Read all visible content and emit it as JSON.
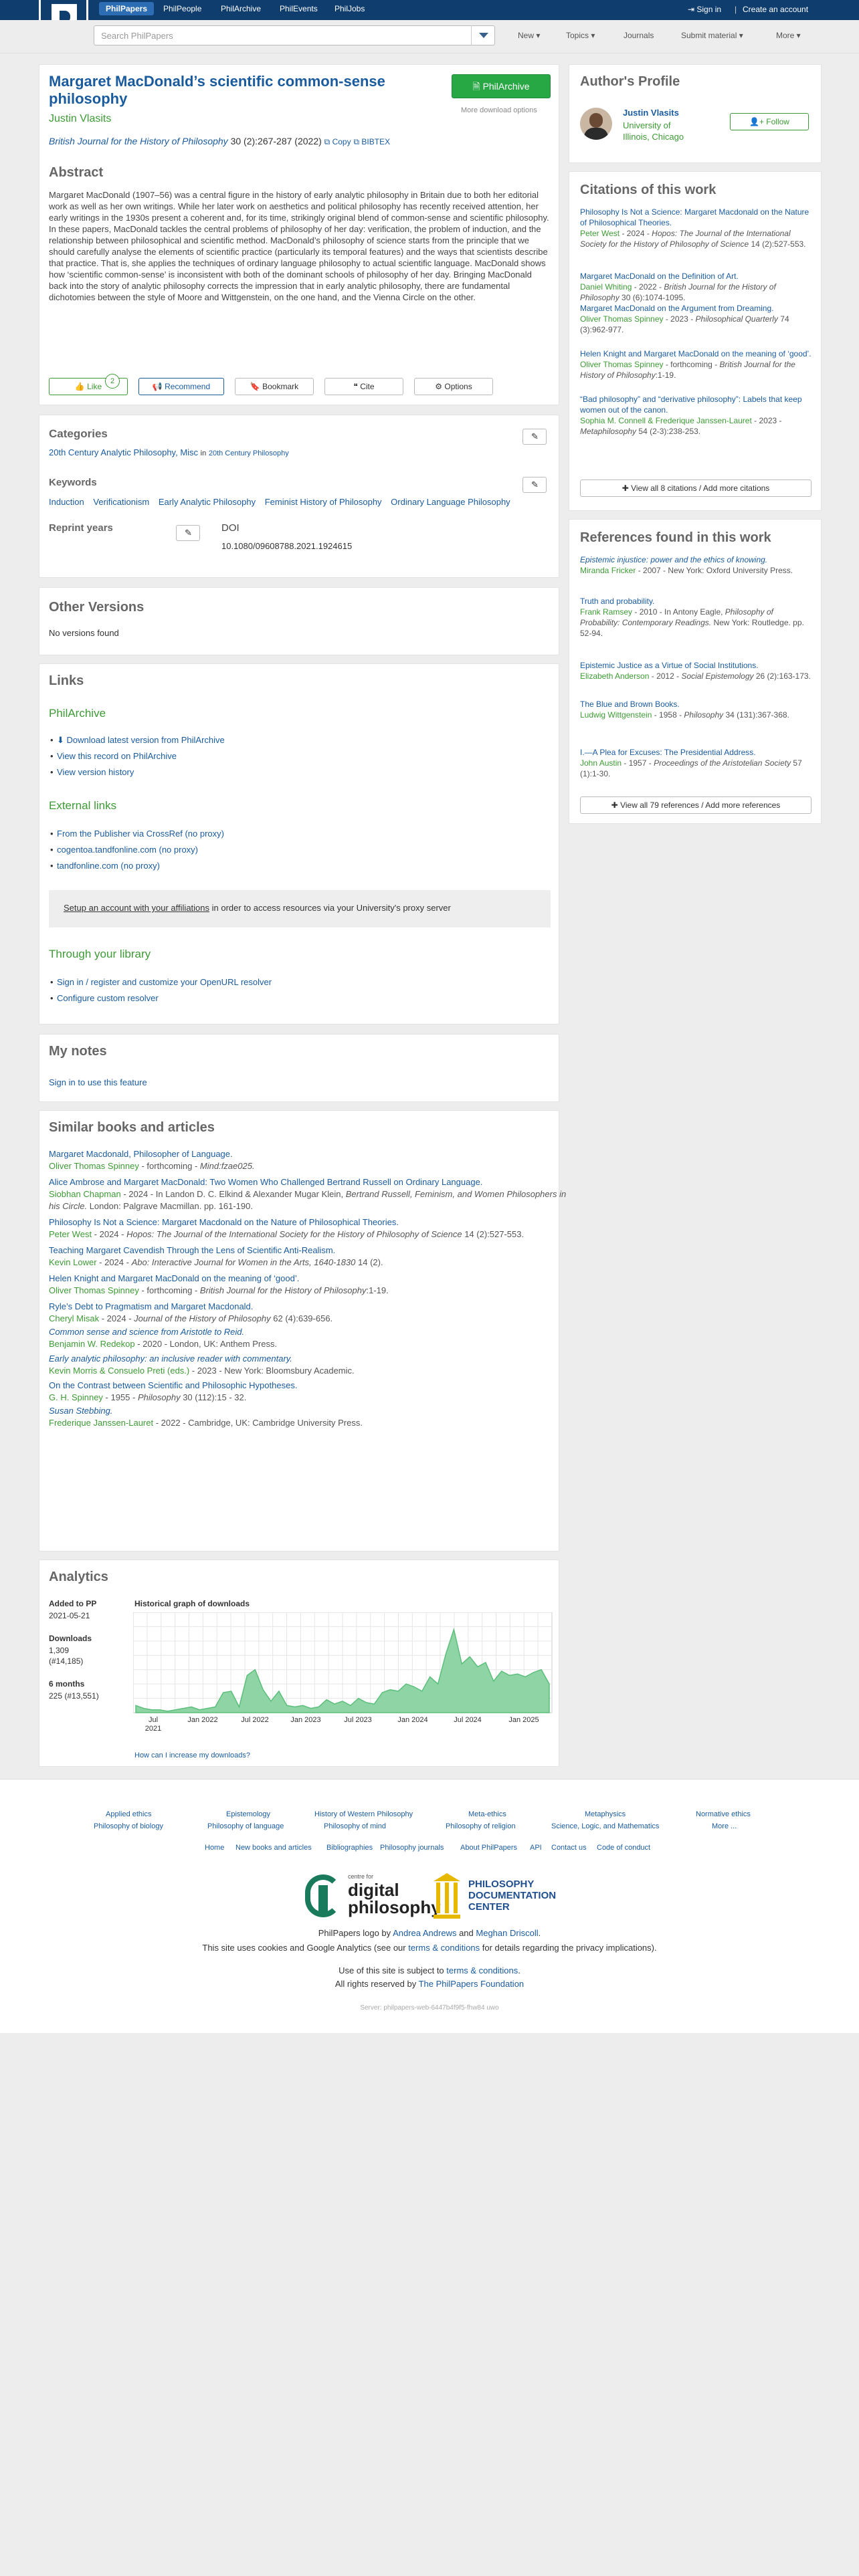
{
  "nav": {
    "brand": "PhilPapers",
    "items": [
      "PhilPeople",
      "PhilArchive",
      "PhilEvents",
      "PhilJobs"
    ],
    "sign_in": "Sign in",
    "create_account": "Create an account"
  },
  "search": {
    "placeholder": "Search PhilPapers"
  },
  "menu": [
    "New",
    "Topics",
    "Journals",
    "Submit material",
    "More"
  ],
  "article": {
    "title": "Margaret MacDonald’s scientific common-sense philosophy",
    "author": "Justin Vlasits",
    "journal": "British Journal for the History of Philosophy",
    "citation": "30 (2):267-287 (2022)",
    "copy": "Copy",
    "bibtex": "BIBTEX",
    "philarchive_btn": "PhilArchive",
    "more_download": "More download options",
    "abstract_heading": "Abstract",
    "abstract": "Margaret MacDonald (1907–56) was a central figure in the history of early analytic philosophy in Britain due to both her editorial work as well as her own writings. While her later work on aesthetics and political philosophy has recently received attention, her early writings in the 1930s present a coherent and, for its time, strikingly original blend of common-sense and scientific philosophy. In these papers, MacDonald tackles the central problems of philosophy of her day: verification, the problem of induction, and the relationship between philosophical and scientific method. MacDonald’s philosophy of science starts from the principle that we should carefully analyse the elements of scientific practice (particularly its temporal features) and the ways that scientists describe that practice. That is, she applies the techniques of ordinary language philosophy to actual scientific language. MacDonald shows how ‘scientific common-sense’ is inconsistent with both of the dominant schools of philosophy of her day. Bringing MacDonald back into the story of analytic philosophy corrects the impression that in early analytic philosophy, there are fundamental dichotomies between the style of Moore and Wittgenstein, on the one hand, and the Vienna Circle on the other.",
    "actions": {
      "like": "Like",
      "like_count": "2",
      "recommend": "Recommend",
      "bookmark": "Bookmark",
      "cite": "Cite",
      "options": "Options"
    }
  },
  "categories": {
    "heading": "Categories",
    "main": "20th Century Analytic Philosophy, Misc",
    "in": "in",
    "parent": "20th Century Philosophy",
    "keywords_heading": "Keywords",
    "keywords": [
      "Induction",
      "Verificationism",
      "Early Analytic Philosophy",
      "Feminist History of Philosophy",
      "Ordinary Language Philosophy"
    ],
    "reprint_heading": "Reprint years",
    "doi_heading": "DOI",
    "doi": "10.1080/09608788.2021.1924615"
  },
  "versions": {
    "heading": "Other Versions",
    "text": "No versions found"
  },
  "links": {
    "heading": "Links",
    "philarchive_heading": "PhilArchive",
    "philarchive": [
      "Download latest version from PhilArchive",
      "View this record on PhilArchive",
      "View version history"
    ],
    "external_heading": "External links",
    "external": [
      "From the Publisher via CrossRef (no proxy)",
      "cogentoa.tandfonline.com (no proxy)",
      "tandfonline.com (no proxy)"
    ],
    "proxy_link": "Setup an account with your affiliations",
    "proxy_text": " in order to access resources via your University's proxy server",
    "library_heading": "Through your library",
    "library": [
      "Sign in / register and customize your OpenURL resolver",
      "Configure custom resolver"
    ]
  },
  "notes": {
    "heading": "My notes",
    "sign_in": "Sign in to use this feature"
  },
  "similar": {
    "heading": "Similar books and articles",
    "items": [
      {
        "title": "Margaret Macdonald, Philosopher of Language.",
        "authors": "Oliver Thomas Spinney",
        "meta": " - forthcoming - ",
        "venue": "Mind:fzae025."
      },
      {
        "title": "Alice Ambrose and Margaret MacDonald: Two Women Who Challenged Bertrand Russell on Ordinary Language.",
        "authors": "Siobhan Chapman",
        "meta": " - 2024 - In Landon D. C. Elkind & Alexander Mugar Klein, ",
        "venue": "Bertrand Russell, Feminism, and Women Philosophers in his Circle.",
        "tail": " London: Palgrave Macmillan. pp. 161-190."
      },
      {
        "title": "Philosophy Is Not a Science: Margaret Macdonald on the Nature of Philosophical Theories.",
        "authors": "Peter West",
        "meta": " - 2024 - ",
        "venue": "Hopos: The Journal of the International Society for the History of Philosophy of Science",
        "tail": " 14 (2):527-553."
      },
      {
        "title": "Teaching Margaret Cavendish Through the Lens of Scientific Anti-Realism.",
        "authors": "Kevin Lower",
        "meta": " - 2024 - ",
        "venue": "Abo: Interactive Journal for Women in the Arts, 1640-1830",
        "tail": " 14 (2)."
      },
      {
        "title": "Helen Knight and Margaret MacDonald on the meaning of ‘good’.",
        "authors": "Oliver Thomas Spinney",
        "meta": " - forthcoming - ",
        "venue": "British Journal for the History of Philosophy",
        "tail": ":1-19."
      },
      {
        "title": "Ryle’s Debt to Pragmatism and Margaret Macdonald.",
        "authors": "Cheryl Misak",
        "meta": " - 2024 - ",
        "venue": "Journal of the History of Philosophy",
        "tail": " 62 (4):639-656."
      },
      {
        "title": "Common sense and science from Aristotle to Reid.",
        "authors": "Benjamin W. Redekop",
        "meta": " - 2020 - London, UK: Anthem Press.",
        "venue": "",
        "tail": "",
        "italic_title": true
      },
      {
        "title": "Early analytic philosophy: an inclusive reader with commentary.",
        "authors": "Kevin Morris & Consuelo Preti (eds.)",
        "meta": " - 2023 - New York: Bloomsbury Academic.",
        "venue": "",
        "tail": "",
        "italic_title": true
      },
      {
        "title": "On the Contrast between Scientific and Philosophic Hypotheses.",
        "authors": "G. H. Spinney",
        "meta": " - 1955 - ",
        "venue": "Philosophy",
        "tail": " 30 (112):15 - 32."
      },
      {
        "title": "Susan Stebbing.",
        "authors": "Frederique Janssen-Lauret",
        "meta": " - 2022 - Cambridge, UK: Cambridge University Press.",
        "venue": "",
        "tail": "",
        "italic_title": true
      }
    ]
  },
  "analytics": {
    "heading": "Analytics",
    "added_label": "Added to PP",
    "added": "2021-05-21",
    "downloads_label": "Downloads",
    "downloads": "1,309",
    "downloads_rank": "(#14,185)",
    "six_label": "6 months",
    "six": "225 (#13,551)",
    "graph_title": "Historical graph of downloads",
    "increase_link": "How can I increase my downloads?"
  },
  "chart_data": {
    "type": "area",
    "title": "Historical graph of downloads",
    "x_ticks": [
      "Jul 2021",
      "Jan 2022",
      "Jul 2022",
      "Jan 2023",
      "Jul 2023",
      "Jan 2024",
      "Jul 2024",
      "Jan 2025"
    ],
    "values": [
      5,
      3,
      2,
      2,
      1,
      2,
      3,
      4,
      2,
      3,
      4,
      14,
      15,
      4,
      26,
      30,
      16,
      8,
      15,
      5,
      4,
      5,
      3,
      4,
      9,
      6,
      8,
      5,
      10,
      7,
      6,
      14,
      16,
      15,
      20,
      18,
      15,
      25,
      20,
      41,
      58,
      34,
      39,
      32,
      35,
      22,
      29,
      26,
      27,
      25,
      28,
      30,
      20
    ],
    "ylim": [
      0,
      70
    ],
    "grid": true,
    "color": "#8fd4a4"
  },
  "profile": {
    "heading": "Author's Profile",
    "name": "Justin Vlasits",
    "affiliation": "University of Illinois, Chicago",
    "follow": "Follow"
  },
  "citations": {
    "heading": "Citations of this work",
    "items": [
      {
        "title": "Philosophy Is Not a Science: Margaret Macdonald on the Nature of Philosophical Theories.",
        "authors": "Peter West",
        "meta": " - 2024 - ",
        "venue": "Hopos: The Journal of the International Society for the History of Philosophy of Science",
        "tail": " 14 (2):527-553."
      },
      {
        "title": "Margaret MacDonald on the Definition of Art.",
        "authors": "Daniel Whiting",
        "meta": " - 2022 - ",
        "venue": "British Journal for the History of Philosophy",
        "tail": " 30 (6):1074-1095."
      },
      {
        "title": "Margaret MacDonald on the Argument from Dreaming.",
        "authors": "Oliver Thomas Spinney",
        "meta": " - 2023 - ",
        "venue": "Philosophical Quarterly",
        "tail": " 74 (3):962-977."
      },
      {
        "title": "Helen Knight and Margaret MacDonald on the meaning of ‘good’.",
        "authors": "Oliver Thomas Spinney",
        "meta": " - forthcoming - ",
        "venue": "British Journal for the History of Philosophy",
        "tail": ":1-19."
      },
      {
        "title": "“Bad philosophy” and “derivative philosophy”: Labels that keep women out of the canon.",
        "authors": "Sophia M. Connell & Frederique Janssen-Lauret",
        "meta": " - 2023 - ",
        "venue": "Metaphilosophy",
        "tail": " 54 (2-3):238-253."
      }
    ],
    "view_all": "View all 8 citations / Add more citations"
  },
  "references": {
    "heading": "References found in this work",
    "items": [
      {
        "title": "Epistemic injustice: power and the ethics of knowing.",
        "authors": "Miranda Fricker",
        "meta": " - 2007 - New York: Oxford University Press.",
        "venue": "",
        "tail": "",
        "italic_title": true
      },
      {
        "title": "Truth and probability.",
        "authors": "Frank Ramsey",
        "meta": " - 2010 - In Antony Eagle, ",
        "venue": "Philosophy of Probability: Contemporary Readings.",
        "tail": " New York: Routledge. pp. 52-94."
      },
      {
        "title": "Epistemic Justice as a Virtue of Social Institutions.",
        "authors": "Elizabeth Anderson",
        "meta": " - 2012 - ",
        "venue": "Social Epistemology",
        "tail": " 26 (2):163-173."
      },
      {
        "title": "The Blue and Brown Books.",
        "authors": "Ludwig Wittgenstein",
        "meta": " - 1958 - ",
        "venue": "Philosophy",
        "tail": " 34 (131):367-368."
      },
      {
        "title": "I.—A Plea for Excuses: The Presidential Address.",
        "authors": "John Austin",
        "meta": " - 1957 - ",
        "venue": "Proceedings of the Aristotelian Society",
        "tail": " 57 (1):1-30."
      }
    ],
    "view_all": "View all 79 references / Add more references"
  },
  "footer": {
    "row1": [
      "Applied ethics",
      "Epistemology",
      "History of Western Philosophy",
      "Meta-ethics",
      "Metaphysics",
      "Normative ethics"
    ],
    "row2": [
      "Philosophy of biology",
      "Philosophy of language",
      "Philosophy of mind",
      "Philosophy of religion",
      "Science, Logic, and Mathematics",
      "More ..."
    ],
    "row3": [
      "Home",
      "New books and articles",
      "Bibliographies",
      "Philosophy journals",
      "About PhilPapers",
      "API",
      "Contact us",
      "Code of conduct"
    ],
    "cdp_small": "centre for",
    "cdp_big1": "digital",
    "cdp_big2": "philosophy",
    "pdc": "PHILOSOPHY DOCUMENTATION CENTER",
    "logo_by": "PhilPapers logo by ",
    "logo_a1": "Andrea Andrews",
    "logo_and": " and ",
    "logo_a2": "Meghan Driscoll",
    "logo_end": ".",
    "cookies_pre": "This site uses cookies and Google Analytics (see our ",
    "cookies_link": "terms & conditions",
    "cookies_post": " for details regarding the privacy implications).",
    "terms_pre": "Use of this site is subject to ",
    "terms_link": "terms & conditions",
    "terms_post": ".",
    "rights_pre": "All rights reserved by ",
    "rights_link": "The PhilPapers Foundation",
    "server": "Server: philpapers-web-6447b4f9f5-fhw84 uwo"
  }
}
